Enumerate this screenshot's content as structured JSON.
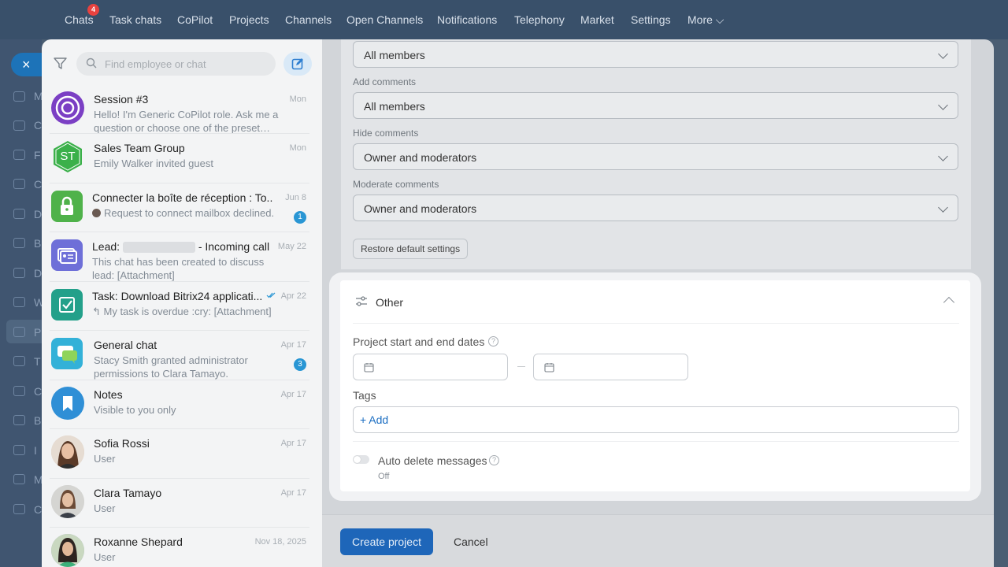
{
  "topnav": {
    "items": [
      "Chats",
      "Task chats",
      "CoPilot",
      "Projects",
      "Channels",
      "Open Channels",
      "Notifications",
      "Telephony",
      "Market",
      "Settings",
      "More ⌵"
    ],
    "chats_badge": "4"
  },
  "rail": {
    "letters": [
      "M",
      "C",
      "F",
      "C",
      "D",
      "B",
      "D",
      "W",
      "P",
      "T",
      "C",
      "B",
      "I",
      "M",
      "C"
    ],
    "badge": "4"
  },
  "search": {
    "placeholder": "Find employee or chat"
  },
  "chats": [
    {
      "title": "Session #3",
      "subtitle": "Hello! I'm Generic CoPilot role. Ask me a question or choose one of the preset…",
      "date": "Mon",
      "badge": "",
      "avatar_color": "#7b3fc4",
      "avatar_text": ""
    },
    {
      "title": "Sales Team Group",
      "subtitle": "Emily Walker invited guest",
      "date": "Mon",
      "badge": "",
      "avatar_color": "#3bb04a",
      "avatar_text": "ST"
    },
    {
      "title": "Connecter la boîte de réception : To...",
      "subtitle": "Request to connect mailbox declined.",
      "date": "Jun 8",
      "badge": "1",
      "avatar_color": "#4fb24a",
      "avatar_text": ""
    },
    {
      "title_prefix": "Lead:",
      "title_suffix": "- Incoming call",
      "subtitle": "This chat has been created to discuss lead: [Attachment]",
      "date": "May 22",
      "badge": "",
      "avatar_color": "#6e6fd8",
      "avatar_text": ""
    },
    {
      "title": "Task: Download Bitrix24 applicati...",
      "subtitle": "↰ My task is overdue :cry: [Attachment]",
      "date": "Apr 22",
      "badge": "",
      "avatar_color": "#23a08a",
      "avatar_text": ""
    },
    {
      "title": "General chat",
      "subtitle": "Stacy Smith granted administrator permissions to Clara Tamayo.",
      "date": "Apr 17",
      "badge": "3",
      "avatar_color": "#33b1d8",
      "avatar_text": ""
    },
    {
      "title": "Notes",
      "subtitle": "Visible to you only",
      "date": "Apr 17",
      "badge": "",
      "avatar_color": "#2f8fd6",
      "avatar_text": ""
    },
    {
      "title": "Sofia Rossi",
      "subtitle": "User",
      "date": "Apr 17",
      "badge": "",
      "avatar_color": "#b9856a",
      "avatar_text": ""
    },
    {
      "title": "Clara Tamayo",
      "subtitle": "User",
      "date": "Apr 17",
      "badge": "",
      "avatar_color": "#9b7b6b",
      "avatar_text": ""
    },
    {
      "title": "Roxanne Shepard",
      "subtitle": "User",
      "date": "Nov 18, 2025",
      "badge": "",
      "avatar_color": "#7a9470",
      "avatar_text": ""
    }
  ],
  "permissions": [
    {
      "label": "",
      "value": "All members"
    },
    {
      "label": "Add comments",
      "value": "All members"
    },
    {
      "label": "Hide comments",
      "value": "Owner and moderators"
    },
    {
      "label": "Moderate comments",
      "value": "Owner and moderators"
    }
  ],
  "restore_label": "Restore default settings",
  "other": {
    "title": "Other",
    "dates_label": "Project start and end dates",
    "tags_label": "Tags",
    "add_tag": "+ Add",
    "auto_delete_label": "Auto delete messages",
    "auto_delete_state": "Off",
    "help_glyph": "?"
  },
  "footer": {
    "create": "Create project",
    "cancel": "Cancel"
  },
  "colors": {
    "accent": "#1e66b9",
    "link": "#1b6ec2",
    "badge": "#2996d4",
    "alert": "#e8423f"
  }
}
